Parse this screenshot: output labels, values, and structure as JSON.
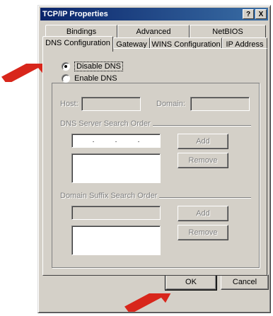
{
  "window": {
    "title": "TCP/IP Properties",
    "help_button": "?",
    "close_button": "X"
  },
  "tabs_top": [
    "Bindings",
    "Advanced",
    "NetBIOS"
  ],
  "tabs_bottom": [
    "DNS Configuration",
    "Gateway",
    "WINS Configuration",
    "IP Address"
  ],
  "dns": {
    "disable_label": "Disable DNS",
    "enable_label": "Enable DNS",
    "host_label": "Host:",
    "domain_label": "Domain:",
    "host_value": "",
    "domain_value": "",
    "server_order_label": "DNS Server Search Order",
    "ip_dots": [
      ".",
      ".",
      "."
    ],
    "add_label": "Add",
    "remove_label": "Remove",
    "suffix_order_label": "Domain Suffix Search Order",
    "add2_label": "Add",
    "remove2_label": "Remove"
  },
  "footer": {
    "ok_label": "OK",
    "cancel_label": "Cancel"
  },
  "colors": {
    "arrow": "#d8261b",
    "titlebar": "#0a246a"
  }
}
